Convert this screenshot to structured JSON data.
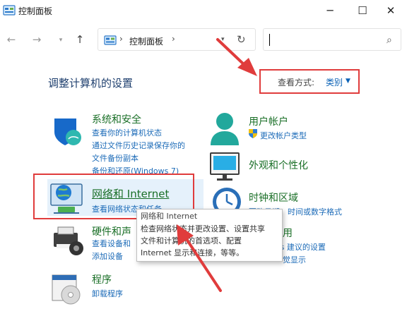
{
  "window": {
    "title": "控制面板",
    "minimize": "─",
    "maximize": "☐",
    "close": "✕"
  },
  "nav": {
    "back": "←",
    "forward": "→",
    "recent": "▾",
    "up": "↑"
  },
  "address": {
    "separator": "›",
    "path": "控制面板",
    "dropdown": "▾",
    "refresh": "↻"
  },
  "search": {
    "icon": "⌕",
    "value": ""
  },
  "page": {
    "title": "调整计算机的设置"
  },
  "view_mode": {
    "label": "查看方式:",
    "value": "类别",
    "arrow": "▼"
  },
  "categories": {
    "system": {
      "title": "系统和安全",
      "icon": "shield-icon",
      "links": [
        "查看你的计算机状态",
        "通过文件历史记录保存你的",
        "文件备份副本",
        "备份和还原(Windows 7)"
      ]
    },
    "network": {
      "title": "网络和 Internet",
      "icon": "globe-icon",
      "links": [
        "查看网络状态和任务"
      ]
    },
    "hardware": {
      "title": "硬件和声",
      "icon": "printer-icon",
      "links": [
        "查看设备和",
        "添加设备"
      ]
    },
    "programs": {
      "title": "程序",
      "icon": "disc-icon",
      "links": [
        "卸载程序"
      ]
    },
    "user": {
      "title": "用户帐户",
      "icon": "user-icon",
      "links": [
        "更改帐户类型"
      ]
    },
    "appearance": {
      "title": "外观和个性化",
      "icon": "monitor-icon",
      "links": []
    },
    "clock": {
      "title": "时钟和区域",
      "icon": "clock-icon",
      "links": [
        "更改日期、时间或数字格式"
      ]
    },
    "access": {
      "title": "用",
      "links": [
        "ndows 建议的设置",
        "觉显示"
      ]
    }
  },
  "tooltip": {
    "title": "网络和 Internet",
    "lines": [
      "检查网络状态并更改设置、设置共享",
      "文件和计算机的首选项、配置",
      "Internet 显示和连接，等等。"
    ]
  },
  "colors": {
    "annotation_red": "#e03c3c",
    "link_blue": "#1c6bb8",
    "category_green": "#1a6f27",
    "heading_navy": "#1e3f6e"
  }
}
